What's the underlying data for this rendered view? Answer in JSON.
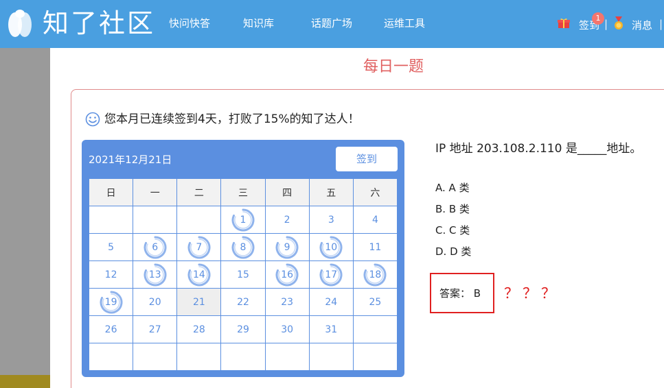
{
  "header": {
    "brand": "知了社区",
    "nav": [
      "快问快答",
      "知识库",
      "话题广场",
      "运维工具"
    ],
    "checkin_label": "签到",
    "checkin_badge": "1",
    "messages_label": "消息",
    "separator": "|"
  },
  "page_title": "每日一题",
  "streak_message": "您本月已连续签到4天，打败了15%的知了达人！",
  "calendar": {
    "date": "2021年12月21日",
    "button_label": "签到",
    "weekdays": [
      "日",
      "一",
      "二",
      "三",
      "四",
      "五",
      "六"
    ],
    "rows": [
      [
        "",
        "",
        "",
        "1",
        "2",
        "3",
        "4"
      ],
      [
        "5",
        "6",
        "7",
        "8",
        "9",
        "10",
        "11"
      ],
      [
        "12",
        "13",
        "14",
        "15",
        "16",
        "17",
        "18"
      ],
      [
        "19",
        "20",
        "21",
        "22",
        "23",
        "24",
        "25"
      ],
      [
        "26",
        "27",
        "28",
        "29",
        "30",
        "31",
        ""
      ],
      [
        "",
        "",
        "",
        "",
        "",
        "",
        ""
      ]
    ],
    "checked_days": [
      "1",
      "6",
      "7",
      "8",
      "9",
      "10",
      "13",
      "14",
      "16",
      "17",
      "18",
      "19"
    ],
    "today": "21"
  },
  "question": {
    "text": "IP 地址 203.108.2.110 是_____地址。",
    "options": [
      "A. A 类",
      "B. B 类",
      "C. C 类",
      "D. D 类"
    ],
    "answer": "答案：  B"
  },
  "annotation": "？？？",
  "colors": {
    "header_bg": "#4a9fe0",
    "calendar_bg": "#5b8fe0",
    "title": "#e06060",
    "annotation": "#e02020"
  },
  "icons": {
    "logo": "cicada-logo-icon",
    "gift": "gift-icon",
    "medal": "medal-icon",
    "smile": "smile-icon",
    "checked_day": "swirl-ring-icon"
  }
}
